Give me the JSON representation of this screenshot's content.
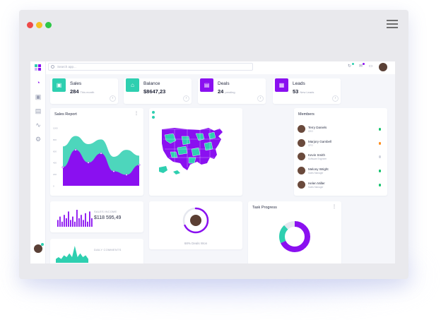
{
  "colors": {
    "teal": "#2ecfb0",
    "purple": "#8a10f0",
    "window_red": "#ee4a48",
    "window_yellow": "#f5c023",
    "window_green": "#2ec747",
    "status_green": "#16c36e",
    "status_orange": "#ff8f1f",
    "status_gray": "#d0d3de"
  },
  "window": {
    "controls": [
      "close",
      "minimize",
      "maximize"
    ],
    "menu_icon": "hamburger-menu-icon"
  },
  "sidebar": {
    "icons": [
      "dashboard-icon",
      "clipboard-icon",
      "briefcase-icon",
      "trend-icon",
      "settings-icon"
    ]
  },
  "topbar": {
    "search_placeholder": "Search app...",
    "icons": [
      "refresh-icon",
      "mail-icon",
      "chat-icon"
    ]
  },
  "stats": [
    {
      "title": "Sales",
      "value": "284",
      "sub": "This month",
      "icon": "wallet-icon",
      "color": "#2ecfb0"
    },
    {
      "title": "Balance",
      "value": "$8647,23",
      "sub": "",
      "icon": "bank-icon",
      "color": "#2ecfb0"
    },
    {
      "title": "Deals",
      "value": "24",
      "sub": "pending",
      "icon": "briefcase-icon",
      "color": "#8a10f0"
    },
    {
      "title": "Leads",
      "value": "53",
      "sub": "New Leads",
      "icon": "folder-icon",
      "color": "#8a10f0"
    }
  ],
  "sales_report": {
    "title": "Sales Report",
    "chart_data": {
      "type": "area",
      "title": "Sales Report",
      "y_ticks": [
        "1000",
        "800",
        "600",
        "400",
        "200",
        "0"
      ],
      "ylim": [
        0,
        1000
      ],
      "x": [
        0,
        1,
        2,
        3,
        4,
        5,
        6
      ],
      "series": [
        {
          "color": "#2ecfb0",
          "values": [
            680,
            860,
            720,
            800,
            500,
            620,
            520
          ]
        },
        {
          "color": "#8a10f0",
          "values": [
            320,
            620,
            400,
            560,
            250,
            190,
            360
          ]
        }
      ],
      "legend": "none",
      "grid": false
    }
  },
  "map": {
    "legend_colors": [
      "#2ecfb0",
      "#8a10f0"
    ]
  },
  "members": {
    "title": "Members",
    "items": [
      {
        "name": "Terry Daniels",
        "role": "CEO",
        "status": "#16c36e"
      },
      {
        "name": "Marjory Gambell",
        "role": "CFO",
        "status": "#ff8f1f"
      },
      {
        "name": "Kevin Smith",
        "role": "Software Engineer",
        "status": "#d0d3de"
      },
      {
        "name": "Melony Wright",
        "role": "Sales Manager",
        "status": "#16c36e"
      },
      {
        "name": "Helen Miller",
        "role": "Sales Manager",
        "status": "#16c36e"
      }
    ]
  },
  "sales_income": {
    "label": "SALES INCOME",
    "value": "$118 595,49",
    "chart_data": {
      "type": "bar",
      "values": [
        4,
        6,
        3,
        7,
        5,
        9,
        4,
        6,
        3,
        10,
        5,
        7,
        4,
        8,
        3,
        9,
        5
      ],
      "color": "#8a10f0"
    }
  },
  "deals_won": {
    "percent": 68,
    "label": "68% Deals Won"
  },
  "daily_comments": {
    "label": "DAILY COMMENTS",
    "chart_data": {
      "type": "line",
      "values": [
        2,
        3,
        2,
        4,
        3,
        5,
        3,
        9,
        3,
        5,
        3,
        4,
        2
      ],
      "color": "#2ecfb0"
    }
  },
  "task_progress": {
    "title": "Task Progress",
    "chart_data": {
      "type": "pie",
      "values": [
        68,
        20,
        12
      ],
      "colors": [
        "#8a10f0",
        "#2ecfb0",
        "#e4e6ee"
      ]
    }
  }
}
